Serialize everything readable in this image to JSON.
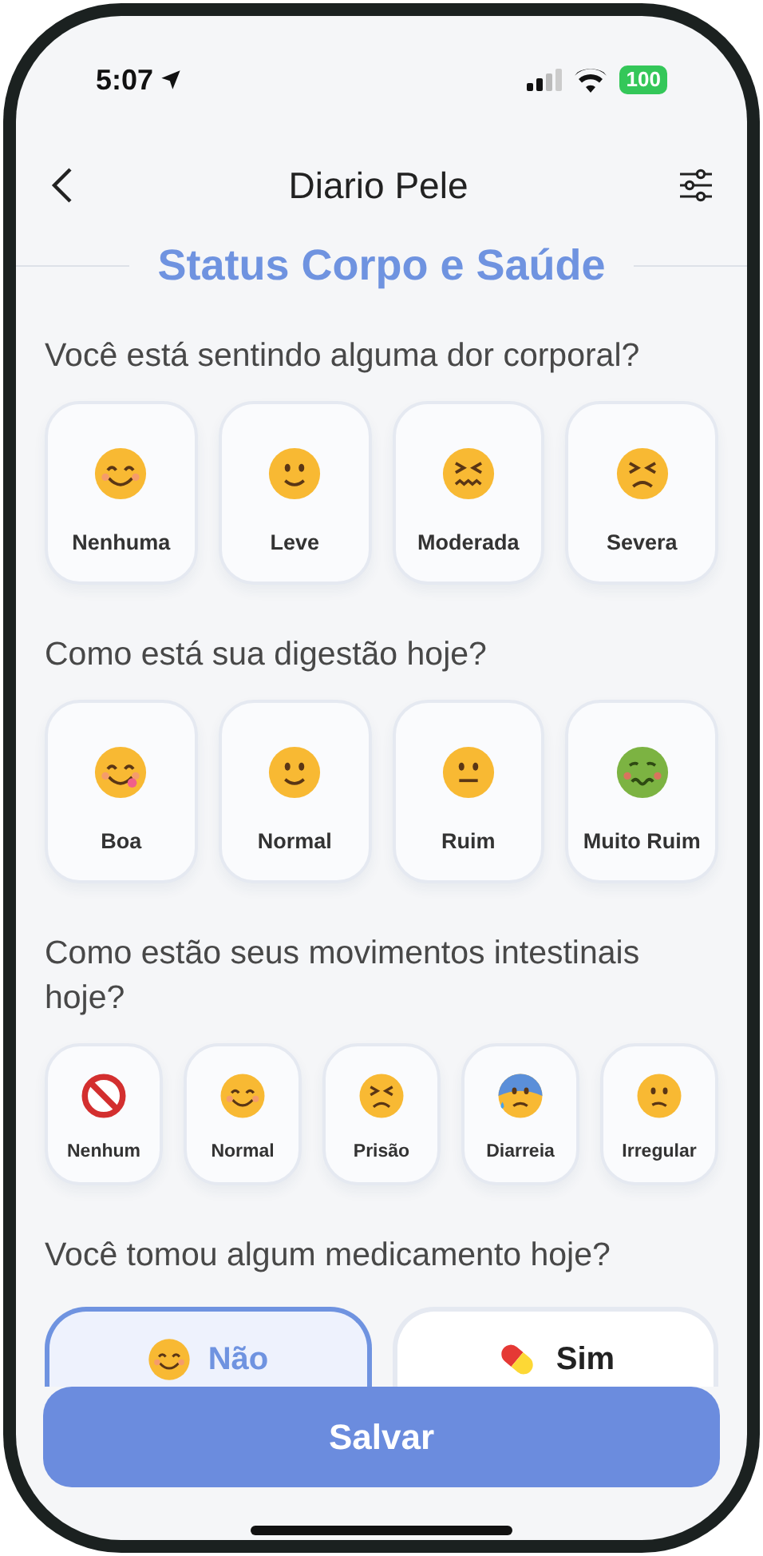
{
  "status_bar": {
    "time": "5:07",
    "battery": "100"
  },
  "header": {
    "title": "Diario Pele"
  },
  "section_title": "Status Corpo e Saúde",
  "questions": [
    {
      "kind": "cards",
      "text": "Você está sentindo alguma dor corporal?",
      "options": [
        {
          "label": "Nenhuma",
          "selected": false
        },
        {
          "label": "Leve",
          "selected": false
        },
        {
          "label": "Moderada",
          "selected": false
        },
        {
          "label": "Severa",
          "selected": false
        }
      ]
    },
    {
      "kind": "cards",
      "text": "Como está sua digestão hoje?",
      "options": [
        {
          "label": "Boa",
          "selected": false
        },
        {
          "label": "Normal",
          "selected": false
        },
        {
          "label": "Ruim",
          "selected": false
        },
        {
          "label": "Muito Ruim",
          "selected": false
        }
      ]
    },
    {
      "kind": "cards",
      "text": "Como estão seus movimentos intestinais hoje?",
      "options": [
        {
          "label": "Nenhum",
          "selected": false
        },
        {
          "label": "Normal",
          "selected": false
        },
        {
          "label": "Prisão",
          "selected": false
        },
        {
          "label": "Diarreia",
          "selected": false
        },
        {
          "label": "Irregular",
          "selected": false
        }
      ]
    },
    {
      "kind": "pair",
      "text": "Você tomou algum medicamento hoje?",
      "options": [
        {
          "label": "Não",
          "selected": true
        },
        {
          "label": "Sim",
          "selected": false
        }
      ]
    }
  ],
  "save_button": "Salvar"
}
